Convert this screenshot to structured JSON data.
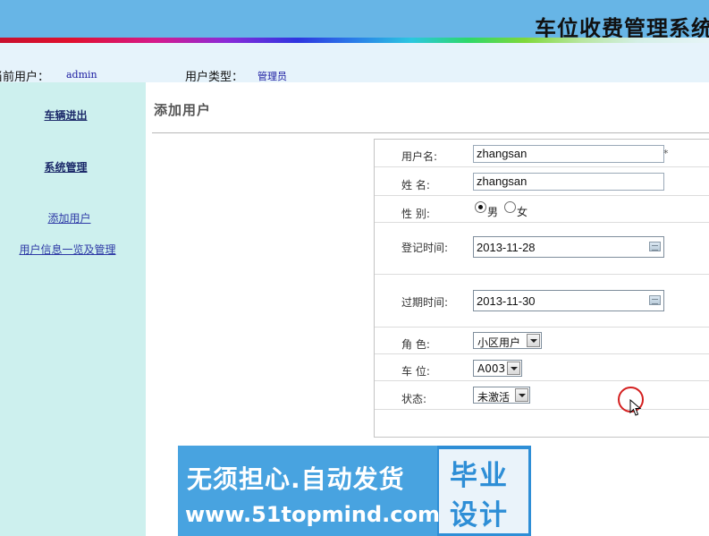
{
  "app": {
    "title": "车位收费管理系统"
  },
  "userbar": {
    "current_user_label": "当前用户：",
    "current_user_value": "admin",
    "user_type_label": "用户类型：",
    "user_type_value": "管理员"
  },
  "sidebar": {
    "sections": [
      "车辆进出",
      "系统管理"
    ],
    "links": [
      "添加用户",
      "用户信息一览及管理"
    ]
  },
  "page": {
    "title": "添加用户"
  },
  "form": {
    "username": {
      "label": "用户名:",
      "value": "zhangsan",
      "required_mark": "*"
    },
    "name": {
      "label": "姓  名:",
      "value": "zhangsan"
    },
    "gender": {
      "label": "性  别:",
      "options": [
        "男",
        "女"
      ],
      "selected": "男"
    },
    "register_time": {
      "label": "登记时间:",
      "value": "2013-11-28"
    },
    "expire_time": {
      "label": "过期时间:",
      "value": "2013-11-30"
    },
    "role": {
      "label": "角  色:",
      "value": "小区用户"
    },
    "parking_space": {
      "label": "车  位:",
      "value": "A003"
    },
    "status": {
      "label": "状态:",
      "value": "未激活"
    }
  },
  "banner": {
    "line1": "无须担心.自动发货",
    "line2": "www.51topmind.com",
    "badge1": "毕业",
    "badge2": "设计"
  },
  "colors": {
    "header_bg": "#67b5e6",
    "sidebar_bg": "#cdf0ee",
    "userbar_bg": "#e6f3fb",
    "banner_bg": "#2e8ed6"
  }
}
